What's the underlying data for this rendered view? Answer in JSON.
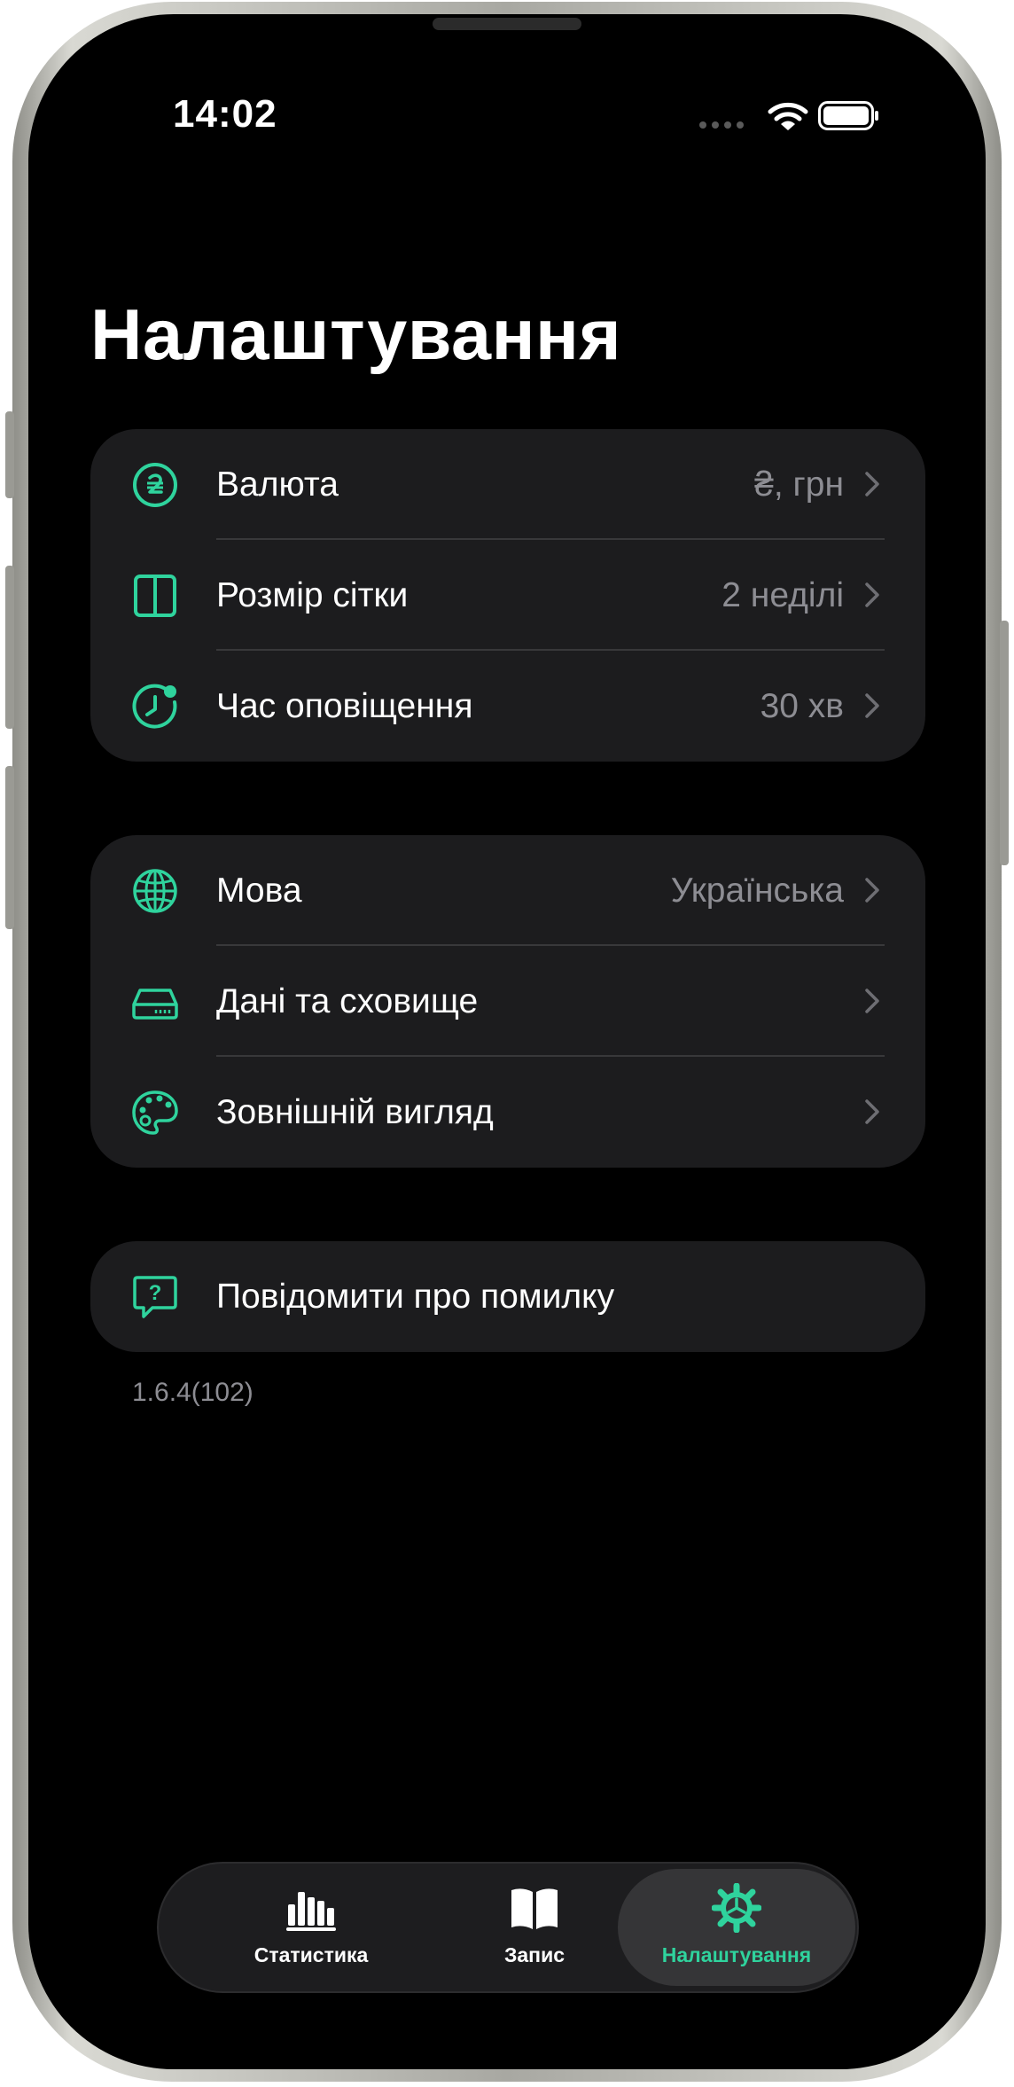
{
  "status_bar": {
    "time": "14:02"
  },
  "page": {
    "title": "Налаштування"
  },
  "group1": [
    {
      "label": "Валюта",
      "value": "₴, грн",
      "icon": "hryvnia-coin-icon"
    },
    {
      "label": "Розмір сітки",
      "value": "2 неділі",
      "icon": "grid-columns-icon"
    },
    {
      "label": "Час оповіщення",
      "value": "30 хв",
      "icon": "clock-alert-icon"
    }
  ],
  "group2": [
    {
      "label": "Мова",
      "value": "Українська",
      "icon": "globe-icon"
    },
    {
      "label": "Дані та сховище",
      "value": "",
      "icon": "storage-drive-icon"
    },
    {
      "label": "Зовнішній вигляд",
      "value": "",
      "icon": "palette-icon"
    }
  ],
  "group3": [
    {
      "label": "Повідомити про помилку",
      "icon": "question-bubble-icon"
    }
  ],
  "version": "1.6.4(102)",
  "tabbar": {
    "tabs": [
      {
        "label": "Статистика",
        "icon": "bar-chart-icon"
      },
      {
        "label": "Запис",
        "icon": "book-icon"
      },
      {
        "label": "Налаштування",
        "icon": "gear-icon"
      }
    ],
    "active": 2
  },
  "colors": {
    "accent": "#2fd39d",
    "background": "#000000",
    "card": "#1c1c1e",
    "secondary_text": "#8d8d93"
  }
}
